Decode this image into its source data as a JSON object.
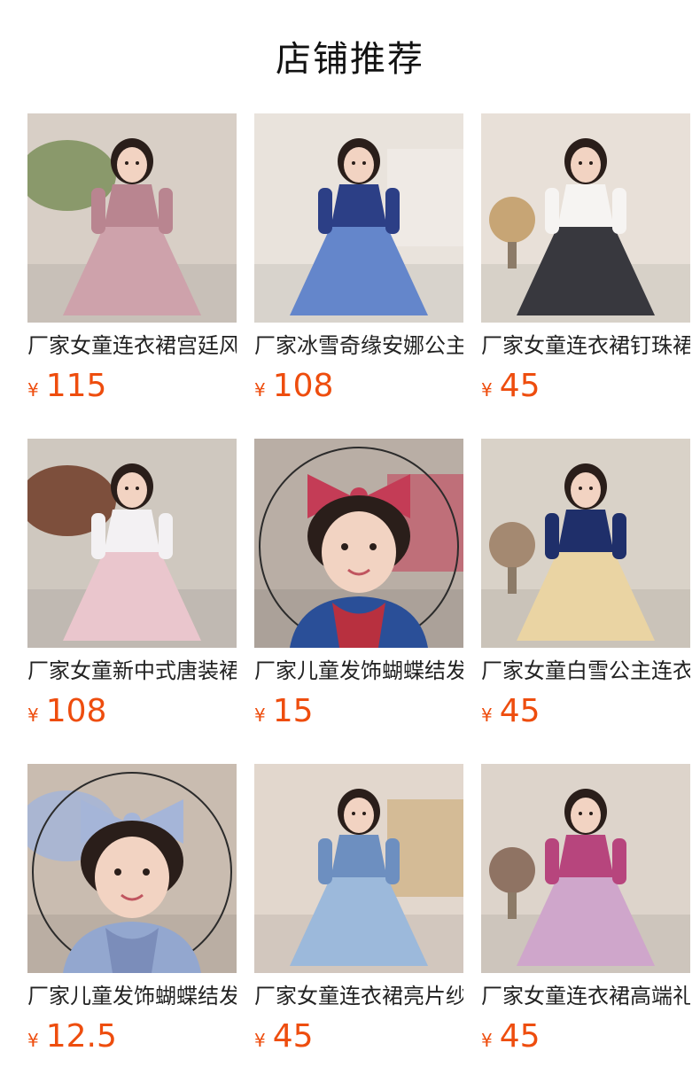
{
  "header": {
    "title": "店铺推荐"
  },
  "colors": {
    "price": "#ee4d0e",
    "title_text": "#222222",
    "background": "#ffffff"
  },
  "products": [
    {
      "title": "厂家女童连衣裙宫廷风",
      "currency": "¥",
      "price": "115",
      "image_icon": "girl-pink-court-dress-photo",
      "palette": {
        "bg": "#d8cfc6",
        "accent": "#7c8f5a",
        "dress": "#c896a0",
        "dress2": "#b98590"
      }
    },
    {
      "title": "厂家冰雪奇缘安娜公主",
      "currency": "¥",
      "price": "108",
      "image_icon": "girl-blue-princess-dress-photo",
      "palette": {
        "bg": "#e9e3dc",
        "accent": "#f4f0ec",
        "dress": "#4f76c4",
        "dress2": "#2c3f86"
      }
    },
    {
      "title": "厂家女童连衣裙钉珠裙",
      "currency": "¥",
      "price": "45",
      "image_icon": "girl-black-velvet-dress-photo",
      "palette": {
        "bg": "#e8e0d8",
        "accent": "#b98c4c",
        "dress": "#1d1d24",
        "dress2": "#f6f4f2"
      }
    },
    {
      "title": "厂家女童新中式唐装裙",
      "currency": "¥",
      "price": "108",
      "image_icon": "girl-pink-tang-suit-photo",
      "palette": {
        "bg": "#cfc8bf",
        "accent": "#6e3a24",
        "dress": "#e8bfc6",
        "dress2": "#f3f1f3"
      }
    },
    {
      "title": "厂家儿童发饰蝴蝶结发箍",
      "currency": "¥",
      "price": "15",
      "image_icon": "girl-red-bow-headband-photo",
      "palette": {
        "bg": "#b9aea5",
        "accent": "#c43c56",
        "dress": "#2a4f98",
        "dress2": "#b8303f"
      }
    },
    {
      "title": "厂家女童白雪公主连衣裙",
      "currency": "¥",
      "price": "45",
      "image_icon": "girl-snow-white-dress-photo",
      "palette": {
        "bg": "#d9d2c8",
        "accent": "#8d6a4b",
        "dress": "#e7cf97",
        "dress2": "#1f2f6a"
      }
    },
    {
      "title": "厂家儿童发饰蝴蝶结发箍",
      "currency": "¥",
      "price": "12.5",
      "image_icon": "girl-blue-bow-headband-photo",
      "palette": {
        "bg": "#c9bcb0",
        "accent": "#a5b5d8",
        "dress": "#93a7cf",
        "dress2": "#7b8dba"
      }
    },
    {
      "title": "厂家女童连衣裙亮片纱裙",
      "currency": "¥",
      "price": "45",
      "image_icon": "girl-blue-tulle-dress-photo",
      "palette": {
        "bg": "#e2d7cd",
        "accent": "#c9a46a",
        "dress": "#8fb0d6",
        "dress2": "#6d8fc0"
      }
    },
    {
      "title": "厂家女童连衣裙高端礼服",
      "currency": "¥",
      "price": "45",
      "image_icon": "girl-purple-gown-photo",
      "palette": {
        "bg": "#ddd4cb",
        "accent": "#6d4a36",
        "dress": "#c99ac4",
        "dress2": "#b7457d"
      }
    }
  ]
}
